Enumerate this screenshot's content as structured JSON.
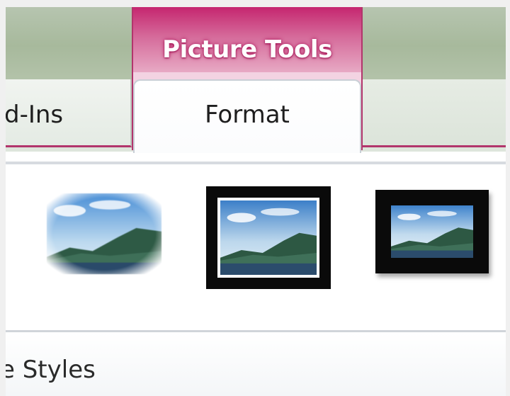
{
  "ribbon": {
    "context_group_label": "Picture Tools",
    "tabs": [
      {
        "label": "d-Ins",
        "active": false
      },
      {
        "label": "Format",
        "active": true
      }
    ],
    "context_color": "#c5266f"
  },
  "gallery": {
    "group_label": "e Styles",
    "items": [
      {
        "style": "soft-edge"
      },
      {
        "style": "double-frame-black"
      },
      {
        "style": "thick-matte-black"
      }
    ]
  }
}
